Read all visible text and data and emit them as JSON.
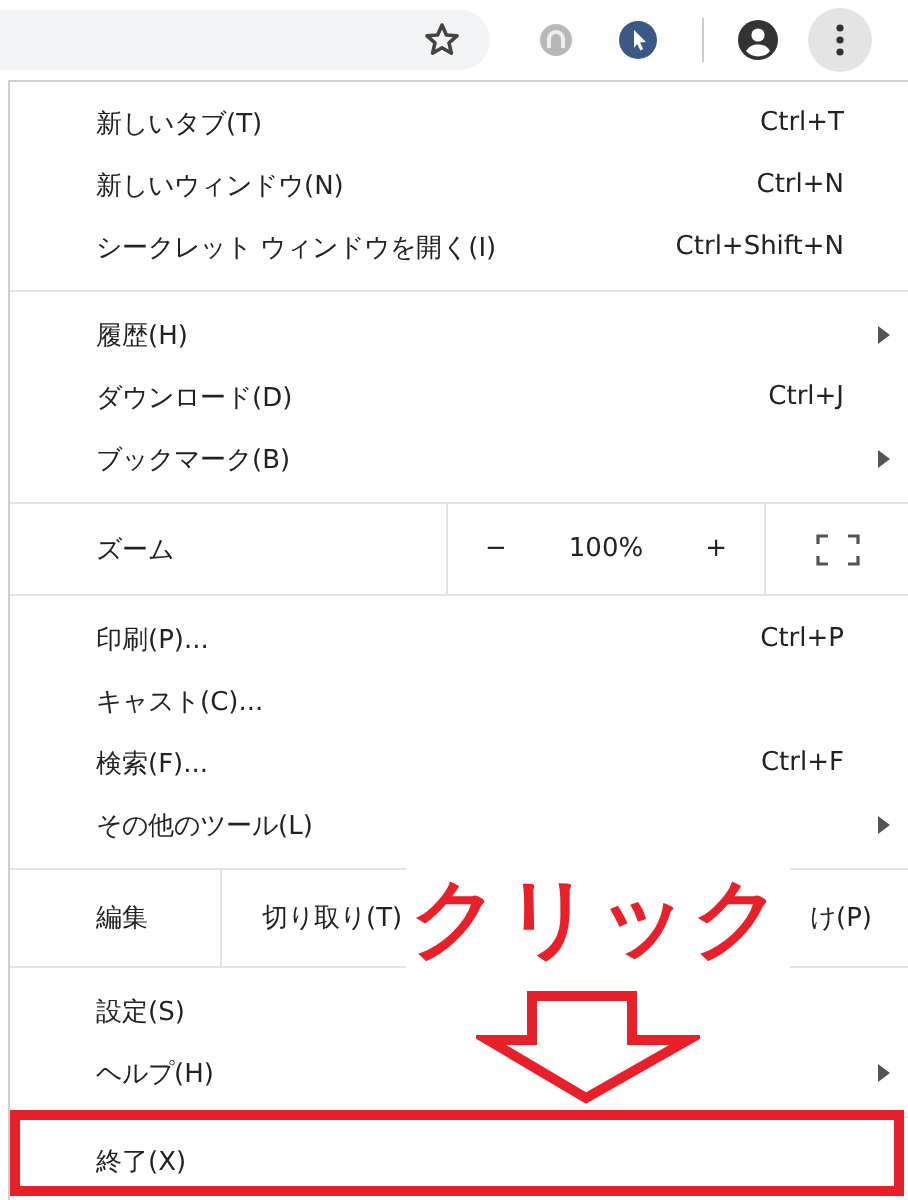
{
  "menu": {
    "sections": [
      {
        "kind": "list",
        "items": [
          {
            "label": "新しいタブ(T)",
            "shortcut": "Ctrl+T",
            "has_submenu": false
          },
          {
            "label": "新しいウィンドウ(N)",
            "shortcut": "Ctrl+N",
            "has_submenu": false
          },
          {
            "label": "シークレット ウィンドウを開く(I)",
            "shortcut": "Ctrl+Shift+N",
            "has_submenu": false
          }
        ]
      },
      {
        "kind": "list",
        "items": [
          {
            "label": "履歴(H)",
            "has_submenu": true
          },
          {
            "label": "ダウンロード(D)",
            "shortcut": "Ctrl+J",
            "has_submenu": false
          },
          {
            "label": "ブックマーク(B)",
            "has_submenu": true
          }
        ]
      },
      {
        "kind": "zoom",
        "label": "ズーム",
        "minus": "−",
        "value": "100%",
        "plus": "+"
      },
      {
        "kind": "list",
        "items": [
          {
            "label": "印刷(P)...",
            "shortcut": "Ctrl+P",
            "has_submenu": false
          },
          {
            "label": "キャスト(C)...",
            "has_submenu": false
          },
          {
            "label": "検索(F)...",
            "shortcut": "Ctrl+F",
            "has_submenu": false
          },
          {
            "label": "その他のツール(L)",
            "has_submenu": true
          }
        ]
      },
      {
        "kind": "edit",
        "label": "編集",
        "actions": [
          "切り取り(T)",
          "け(P)"
        ]
      },
      {
        "kind": "list",
        "items": [
          {
            "label": "設定(S)",
            "has_submenu": false
          },
          {
            "label": "ヘルプ(H)",
            "has_submenu": true
          }
        ]
      },
      {
        "kind": "list",
        "items": [
          {
            "label": "終了(X)",
            "has_submenu": false
          }
        ]
      }
    ]
  },
  "annotation": {
    "text": "クリック"
  }
}
